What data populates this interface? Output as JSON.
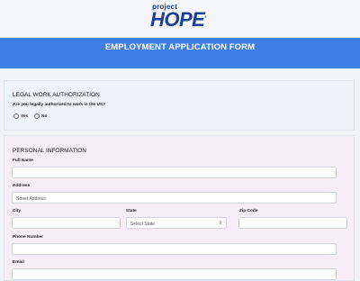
{
  "logo": {
    "line1": "project",
    "line2": "HOPE",
    "tm": "®"
  },
  "banner": {
    "title": "EMPLOYMENT APPLICATION FORM"
  },
  "legal": {
    "title": "LEGAL WORK AUTHORIZATION",
    "question": "Are you legally authorized to work in the US?",
    "options": [
      "Yes",
      "No"
    ]
  },
  "personal": {
    "title": "PERSONAL INFORMATION",
    "full_name_label": "Full Name",
    "address_label": "Address",
    "address_placeholder": "Street Address",
    "city_label": "City",
    "state_label": "State",
    "state_selected": "Select State",
    "zip_label": "Zip Code",
    "phone_label": "Phone Number",
    "email_label": "Email"
  }
}
